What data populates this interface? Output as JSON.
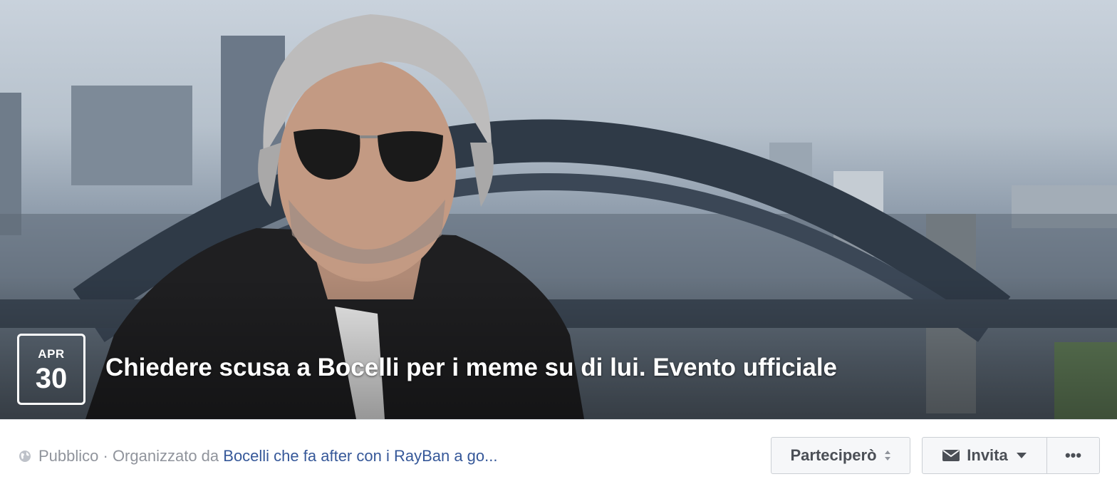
{
  "event": {
    "month": "APR",
    "day": "30",
    "title": "Chiedere scusa a Bocelli per i meme su di lui. Evento ufficiale"
  },
  "meta": {
    "privacy_icon": "globe-icon",
    "privacy": "Pubblico",
    "separator": " · Organizzato da ",
    "organizer": "Bocelli che fa after con i RayBan a go..."
  },
  "actions": {
    "going_label": "Parteciperò",
    "invite_label": "Invita",
    "more_label": "•••"
  },
  "colors": {
    "link": "#365899",
    "muted": "#90949c",
    "button_bg": "#f6f7f9",
    "button_border": "#ccd0d5"
  }
}
